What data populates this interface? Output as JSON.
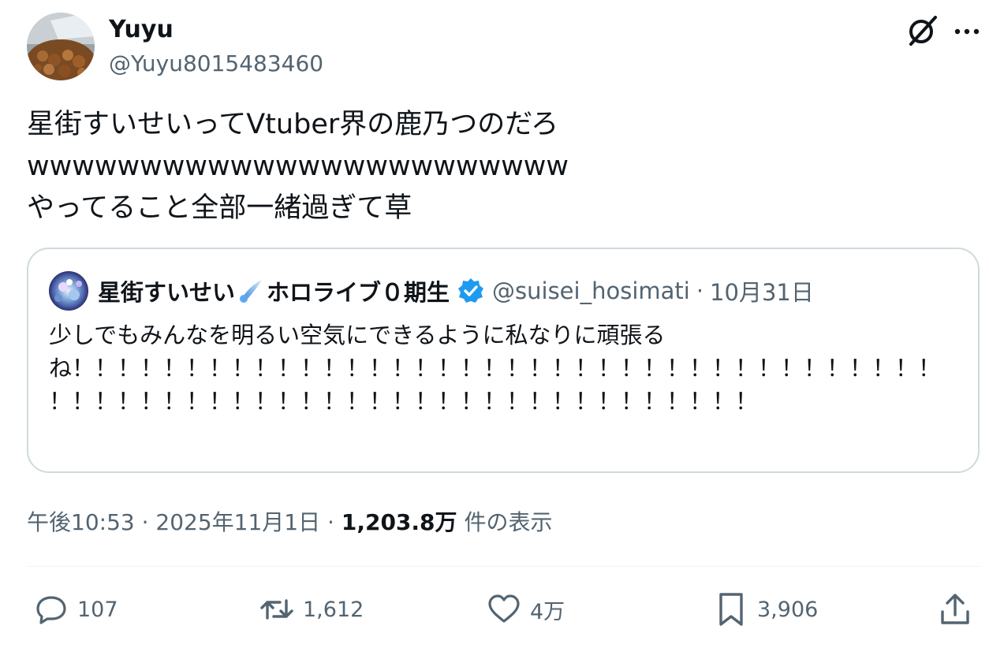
{
  "author": {
    "display_name": "Yuyu",
    "handle": "@Yuyu8015483460",
    "avatar_icon": "natto-photo-avatar"
  },
  "header_icons": {
    "grok": "grok-icon",
    "more": "more-icon"
  },
  "tweet": {
    "lines": [
      "星街すいせいってVtuber界の鹿乃つのだろ",
      "wwwwwwwwwwwwwwwwwwwwwwww",
      "やってること全部一緒過ぎて草"
    ]
  },
  "quote": {
    "name": "星街すいせい",
    "name_suffix": "ホロライブ０期生",
    "handle": "@suisei_hosimati",
    "separator": "·",
    "date": "10月31日",
    "text": "少しでもみんなを明るい空気にできるように私なりに頑張るね！！！！！！！！！！！！！！！！！！！！！！！！！！！！！！！！！！！！！！！！！！！！！！！！！！！！！！！！！！！！！！！！！！！！！",
    "emoji_icon": "comet-icon",
    "verified_icon": "verified-badge-icon"
  },
  "meta": {
    "time": "午後10:53",
    "separator": "·",
    "date": "2025年11月1日",
    "views_count": "1,203.8万",
    "views_label": "件の表示"
  },
  "actions": {
    "reply": "107",
    "retweet": "1,612",
    "like": "4万",
    "bookmark": "3,906"
  },
  "colors": {
    "text_primary": "#0f1419",
    "text_secondary": "#536471",
    "border": "#cfd9de",
    "verified": "#1d9bf0"
  }
}
